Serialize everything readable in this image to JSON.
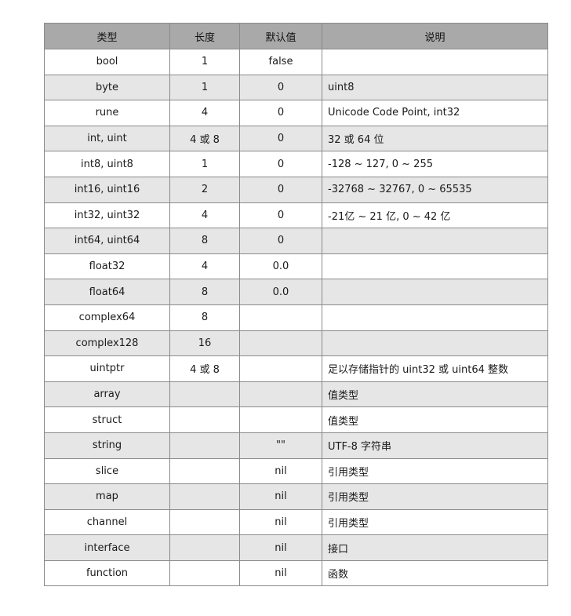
{
  "table": {
    "headers": [
      "类型",
      "长度",
      "默认值",
      "说明"
    ],
    "rows": [
      {
        "type": "bool",
        "length": "1",
        "default": "false",
        "desc": ""
      },
      {
        "type": "byte",
        "length": "1",
        "default": "0",
        "desc": "uint8"
      },
      {
        "type": "rune",
        "length": "4",
        "default": "0",
        "desc": "Unicode Code Point, int32"
      },
      {
        "type": "int, uint",
        "length": "4 或 8",
        "default": "0",
        "desc": "32 或 64 位"
      },
      {
        "type": "int8, uint8",
        "length": "1",
        "default": "0",
        "desc": "-128 ~ 127, 0 ~ 255"
      },
      {
        "type": "int16, uint16",
        "length": "2",
        "default": "0",
        "desc": "-32768 ~ 32767, 0 ~ 65535"
      },
      {
        "type": "int32, uint32",
        "length": "4",
        "default": "0",
        "desc": "-21亿 ~ 21 亿, 0 ~ 42 亿"
      },
      {
        "type": "int64, uint64",
        "length": "8",
        "default": "0",
        "desc": ""
      },
      {
        "type": "float32",
        "length": "4",
        "default": "0.0",
        "desc": ""
      },
      {
        "type": "float64",
        "length": "8",
        "default": "0.0",
        "desc": ""
      },
      {
        "type": "complex64",
        "length": "8",
        "default": "",
        "desc": ""
      },
      {
        "type": "complex128",
        "length": "16",
        "default": "",
        "desc": ""
      },
      {
        "type": "uintptr",
        "length": "4 或 8",
        "default": "",
        "desc": "足以存储指针的 uint32 或 uint64 整数"
      },
      {
        "type": "array",
        "length": "",
        "default": "",
        "desc": "值类型"
      },
      {
        "type": "struct",
        "length": "",
        "default": "",
        "desc": "值类型"
      },
      {
        "type": "string",
        "length": "",
        "default": "\"\"",
        "desc": "UTF-8 字符串"
      },
      {
        "type": "slice",
        "length": "",
        "default": "nil",
        "desc": "引用类型"
      },
      {
        "type": "map",
        "length": "",
        "default": "nil",
        "desc": "引用类型"
      },
      {
        "type": "channel",
        "length": "",
        "default": "nil",
        "desc": "引用类型"
      },
      {
        "type": "interface",
        "length": "",
        "default": "nil",
        "desc": "接口"
      },
      {
        "type": "function",
        "length": "",
        "default": "nil",
        "desc": "函数"
      }
    ]
  },
  "colors": {
    "header_bg": "#a9a9a9",
    "alt_row_bg": "#e6e6e6",
    "border": "#8a8a8a"
  }
}
